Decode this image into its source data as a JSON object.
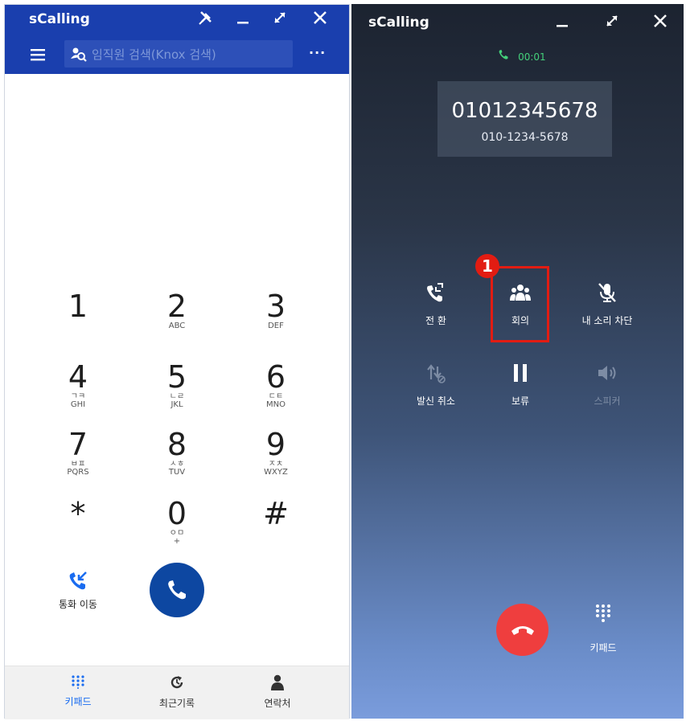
{
  "left": {
    "title": "sCalling",
    "window_icons": [
      "unpin-icon",
      "minimize-icon",
      "maximize-icon",
      "close-icon"
    ],
    "search_placeholder": "임직원 검색(Knox 검색)",
    "more_label": "···",
    "keypad": [
      {
        "digit": "1",
        "korean": "",
        "latin": ""
      },
      {
        "digit": "2",
        "korean": "",
        "latin": "ABC"
      },
      {
        "digit": "3",
        "korean": "",
        "latin": "DEF"
      },
      {
        "digit": "4",
        "korean": "ㄱㅋ",
        "latin": "GHI"
      },
      {
        "digit": "5",
        "korean": "ㄴㄹ",
        "latin": "JKL"
      },
      {
        "digit": "6",
        "korean": "ㄷㅌ",
        "latin": "MNO"
      },
      {
        "digit": "7",
        "korean": "ㅂㅍ",
        "latin": "PQRS"
      },
      {
        "digit": "8",
        "korean": "ㅅㅎ",
        "latin": "TUV"
      },
      {
        "digit": "9",
        "korean": "ㅈㅊ",
        "latin": "WXYZ"
      },
      {
        "digit": "*",
        "korean": "",
        "latin": ""
      },
      {
        "digit": "0",
        "korean": "ㅇㅁ",
        "latin": "+"
      },
      {
        "digit": "#",
        "korean": "",
        "latin": ""
      }
    ],
    "transfer_label": "통화 이동",
    "nav": [
      {
        "label": "키패드",
        "icon": "keypad-icon",
        "active": true
      },
      {
        "label": "최근기록",
        "icon": "recent-icon",
        "active": false
      },
      {
        "label": "연락처",
        "icon": "contact-icon",
        "active": false
      }
    ],
    "colors": {
      "header": "#1a3fae",
      "accent": "#1a6cf0",
      "call_button": "#0d47a1"
    }
  },
  "right": {
    "title": "sCalling",
    "timer": "00:01",
    "number": "01012345678",
    "formatted_number": "010-1234-5678",
    "controls": [
      {
        "label": "전 환",
        "icon": "transfer-icon",
        "enabled": true
      },
      {
        "label": "회의",
        "icon": "conference-icon",
        "enabled": true
      },
      {
        "label": "내 소리 차단",
        "icon": "mute-icon",
        "enabled": true
      },
      {
        "label": "발신 취소",
        "icon": "cancel-forward-icon",
        "enabled": true
      },
      {
        "label": "보류",
        "icon": "hold-icon",
        "enabled": true
      },
      {
        "label": "스피커",
        "icon": "speaker-icon",
        "enabled": false
      }
    ],
    "keypad_label": "키패드",
    "callout": "1",
    "colors": {
      "end_call": "#ef3e3e",
      "timer": "#44d17a",
      "callout": "#e21c12"
    }
  }
}
